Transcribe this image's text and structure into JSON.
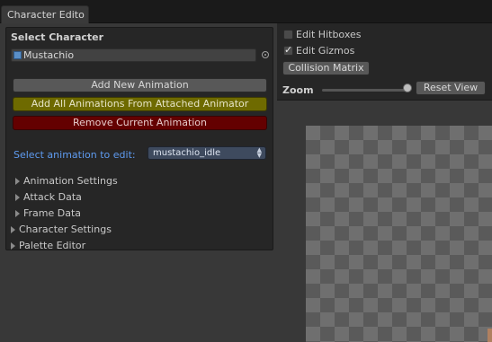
{
  "tab": {
    "title": "Character Edito"
  },
  "left": {
    "section_title": "Select Character",
    "character_field": "Mustachio",
    "buttons": {
      "add_new": "Add New Animation",
      "add_all": "Add All Animations From Attached Animator",
      "remove": "Remove Current Animation"
    },
    "select_label": "Select animation to edit:",
    "select_value": "mustachio_idle",
    "foldouts": {
      "animation_settings": "Animation Settings",
      "attack_data": "Attack Data",
      "frame_data": "Frame Data",
      "character_settings": "Character Settings",
      "palette_editor": "Palette Editor"
    }
  },
  "right": {
    "edit_hitboxes": "Edit Hitboxes",
    "edit_hitboxes_checked": false,
    "edit_gizmos": "Edit Gizmos",
    "edit_gizmos_checked": true,
    "collision_matrix": "Collision Matrix",
    "zoom_label": "Zoom",
    "reset_view": "Reset View"
  },
  "colors": {
    "yellow_button": "#6e6a00",
    "red_button": "#640000",
    "link_blue": "#5e9bf0"
  }
}
